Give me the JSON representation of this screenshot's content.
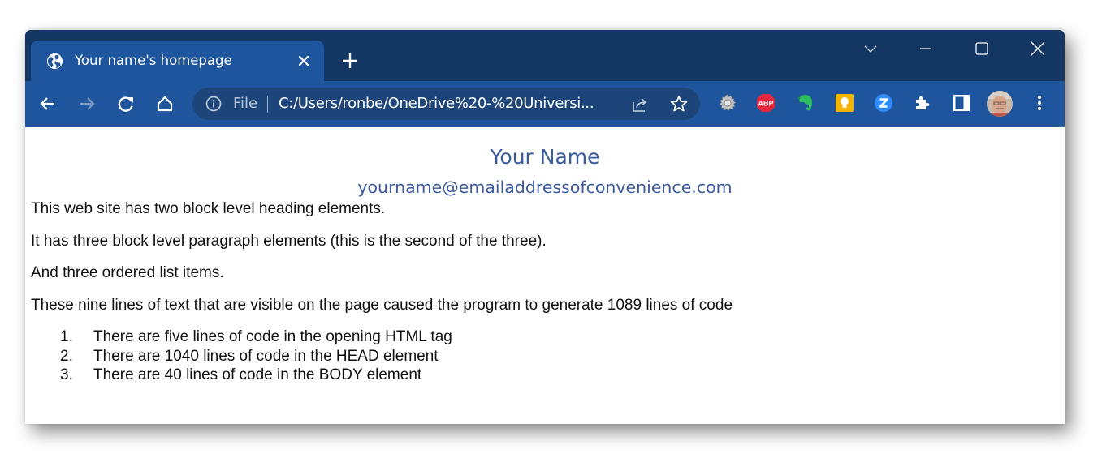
{
  "browser": {
    "tab": {
      "title": "Your name's homepage",
      "icon": "globe-icon",
      "close_icon": "close-icon"
    },
    "new_tab_icon": "plus-icon",
    "window_controls": [
      "chevron-down-icon",
      "minimize-icon",
      "maximize-icon",
      "close-icon"
    ],
    "nav": [
      "back-icon",
      "forward-icon",
      "reload-icon",
      "home-icon"
    ],
    "omnibox": {
      "scheme_label": "File",
      "url": "C:/Users/ronbe/OneDrive%20-%20Universi...",
      "info_icon": "info-icon",
      "share_icon": "share-icon",
      "bookmark_icon": "star-icon"
    },
    "extensions": [
      {
        "name": "settings-gear-extension",
        "icon": "gear-icon"
      },
      {
        "name": "adblock-plus-extension",
        "icon": "abp-icon",
        "label": "ABP",
        "color": "#e3263b"
      },
      {
        "name": "evernote-extension",
        "icon": "elephant-icon",
        "color": "#2dbe60"
      },
      {
        "name": "google-keep-extension",
        "icon": "lightbulb-icon",
        "color": "#f6b400"
      },
      {
        "name": "zoom-extension",
        "icon": "z-icon",
        "label": "Z",
        "color": "#2d8cff"
      },
      {
        "name": "extensions-menu",
        "icon": "puzzle-icon"
      },
      {
        "name": "side-panel",
        "icon": "side-panel-icon"
      },
      {
        "name": "profile-avatar",
        "icon": "avatar-icon"
      },
      {
        "name": "more-menu",
        "icon": "kebab-menu-icon"
      }
    ],
    "colors": {
      "titlebar": "#133663",
      "active_tab": "#1e559c",
      "omnibox": "#1d4579",
      "heading_text": "#3b5a9a"
    }
  },
  "page": {
    "heading": "Your Name",
    "email": "yourname@emailaddressofconvenience.com",
    "paragraphs": [
      "This web site has two block level heading elements.",
      "It has three block level paragraph elements (this is the second of the three).",
      "And three ordered list items.",
      "These nine lines of text that are visible on the page caused the program to generate 1089 lines of code"
    ],
    "list": [
      {
        "num": "1.",
        "text": "There are five lines of code in the opening HTML tag"
      },
      {
        "num": "2.",
        "text": "There are 1040 lines of code in the HEAD element"
      },
      {
        "num": "3.",
        "text": "There are 40 lines of code in the BODY element"
      }
    ]
  }
}
